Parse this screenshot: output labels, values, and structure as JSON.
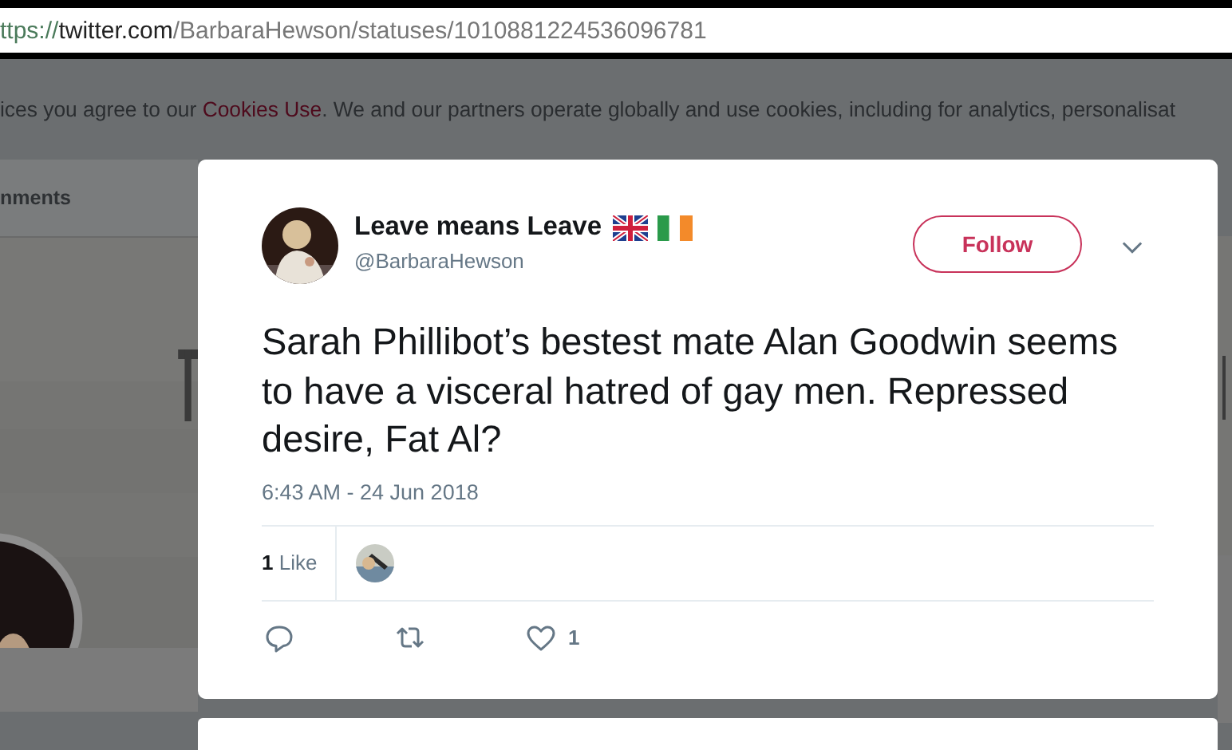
{
  "address_bar": {
    "scheme": "ttps://",
    "host": "twitter.com",
    "path": "/BarbaraHewson/statuses/1010881224536096781"
  },
  "cookie_notice": {
    "before": "ices you agree to our ",
    "link": "Cookies Use",
    "after": ". We and our partners operate globally and use cookies, including for analytics, personalisat"
  },
  "profile_nav": {
    "label": "nments"
  },
  "tweet": {
    "name": "Leave means Leave",
    "flags": [
      {
        "kind": "uk"
      },
      {
        "kind": "ireland"
      }
    ],
    "handle": "@BarbaraHewson",
    "follow_button": "Follow",
    "text": "Sarah Phillibot’s bestest mate Alan Goodwin seems to have a visceral hatred of gay men. Repressed desire, Fat Al?",
    "time": "6:43 AM - 24 Jun 2018",
    "likes_count": "1",
    "likes_label": "Like",
    "actions": [
      {
        "kind": "reply"
      },
      {
        "kind": "retweet"
      },
      {
        "kind": "like",
        "count": "1"
      }
    ]
  }
}
